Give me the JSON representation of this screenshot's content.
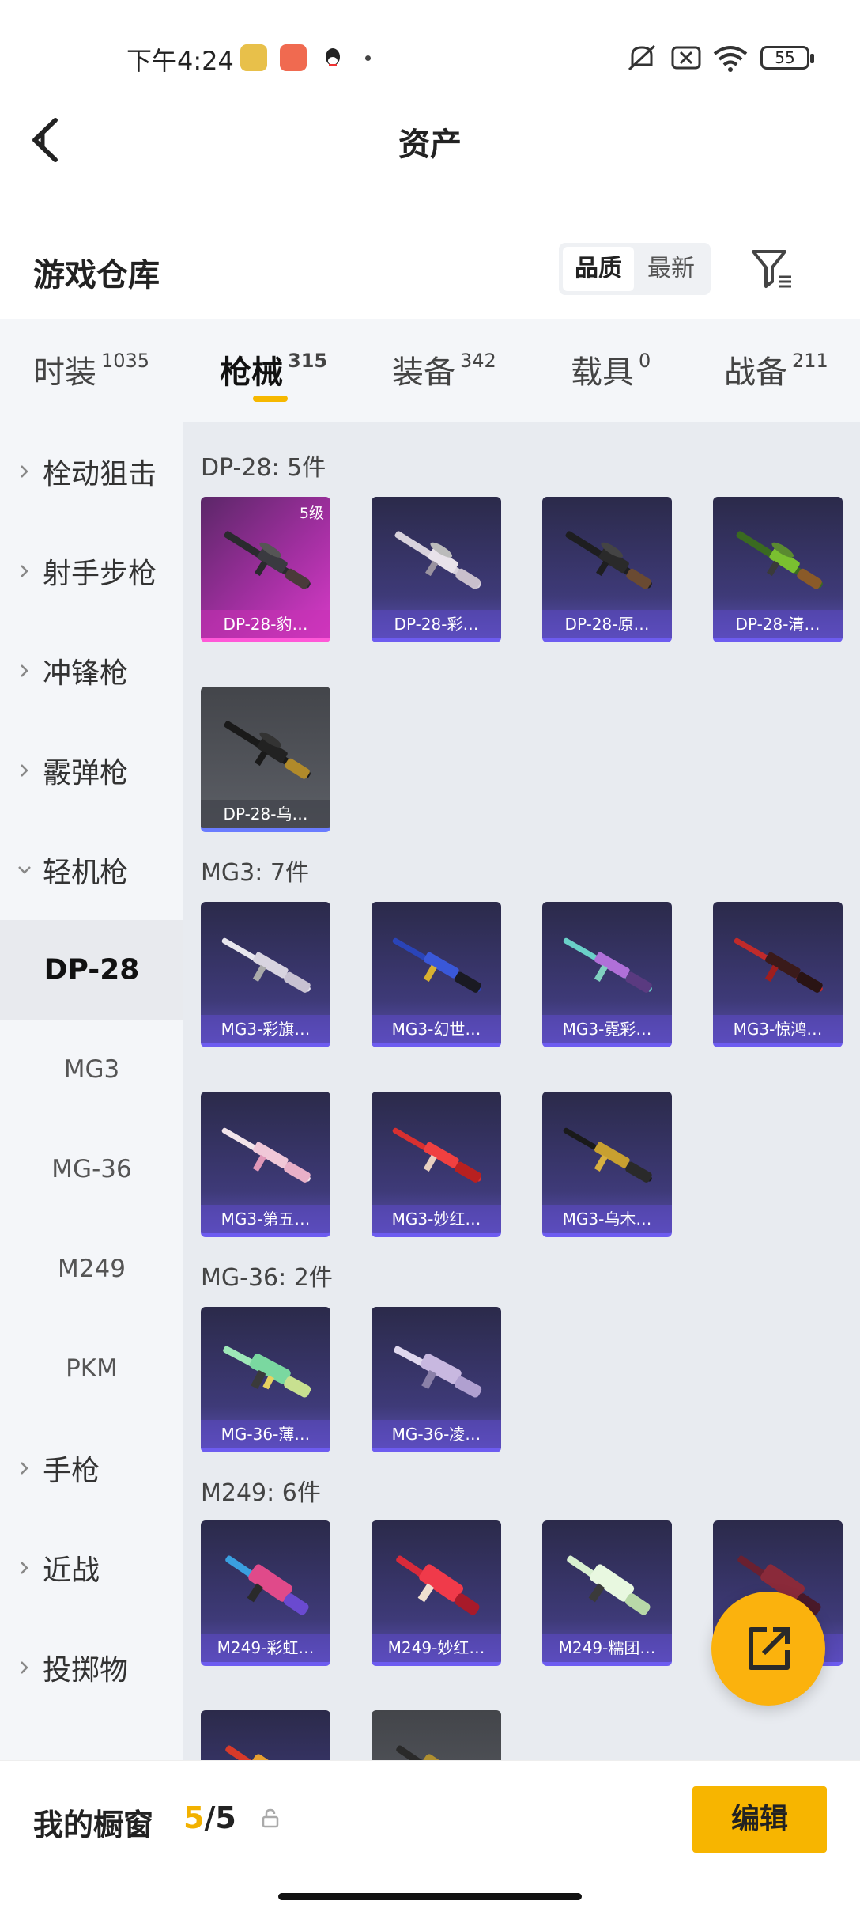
{
  "status_bar": {
    "time": "下午4:24",
    "battery": "55"
  },
  "header": {
    "title": "资产"
  },
  "warehouse": {
    "title": "游戏仓库",
    "sort_options": [
      "品质",
      "最新"
    ]
  },
  "tabs": [
    {
      "label": "时装",
      "count": "1035"
    },
    {
      "label": "枪械",
      "count": "315"
    },
    {
      "label": "装备",
      "count": "342"
    },
    {
      "label": "载具",
      "count": "0"
    },
    {
      "label": "战备",
      "count": "211"
    }
  ],
  "sidebar": {
    "items": [
      {
        "label": "栓动狙击"
      },
      {
        "label": "射手步枪"
      },
      {
        "label": "冲锋枪"
      },
      {
        "label": "霰弹枪"
      },
      {
        "label": "轻机枪"
      },
      {
        "label": "DP-28"
      },
      {
        "label": "MG3"
      },
      {
        "label": "MG-36"
      },
      {
        "label": "M249"
      },
      {
        "label": "PKM"
      },
      {
        "label": "手枪"
      },
      {
        "label": "近战"
      },
      {
        "label": "投掷物"
      }
    ]
  },
  "groups": [
    {
      "title": "DP-28: 5件",
      "items": [
        {
          "name": "DP-28-豹…",
          "level": "5级"
        },
        {
          "name": "DP-28-彩…"
        },
        {
          "name": "DP-28-原…"
        },
        {
          "name": "DP-28-清…"
        },
        {
          "name": "DP-28-乌…"
        }
      ]
    },
    {
      "title": "MG3: 7件",
      "items": [
        {
          "name": "MG3-彩旗…"
        },
        {
          "name": "MG3-幻世…"
        },
        {
          "name": "MG3-霓彩…"
        },
        {
          "name": "MG3-惊鸿…"
        },
        {
          "name": "MG3-第五…"
        },
        {
          "name": "MG3-妙红…"
        },
        {
          "name": "MG3-乌木…"
        }
      ]
    },
    {
      "title": "MG-36: 2件",
      "items": [
        {
          "name": "MG-36-薄…"
        },
        {
          "name": "MG-36-凌…"
        }
      ]
    },
    {
      "title": "M249: 6件",
      "items": [
        {
          "name": "M249-彩虹…"
        },
        {
          "name": "M249-妙红…"
        },
        {
          "name": "M249-糯团…"
        },
        {
          "name": ""
        },
        {
          "name": ""
        },
        {
          "name": ""
        }
      ]
    }
  ],
  "showcase": {
    "label": "我的橱窗",
    "used": "5",
    "separator": "/",
    "total": "5"
  },
  "edit_button": "编辑",
  "colors": {
    "accent": "#f7b500",
    "card_purple": "#3e3a78",
    "card_pink": "#a12fa0"
  }
}
